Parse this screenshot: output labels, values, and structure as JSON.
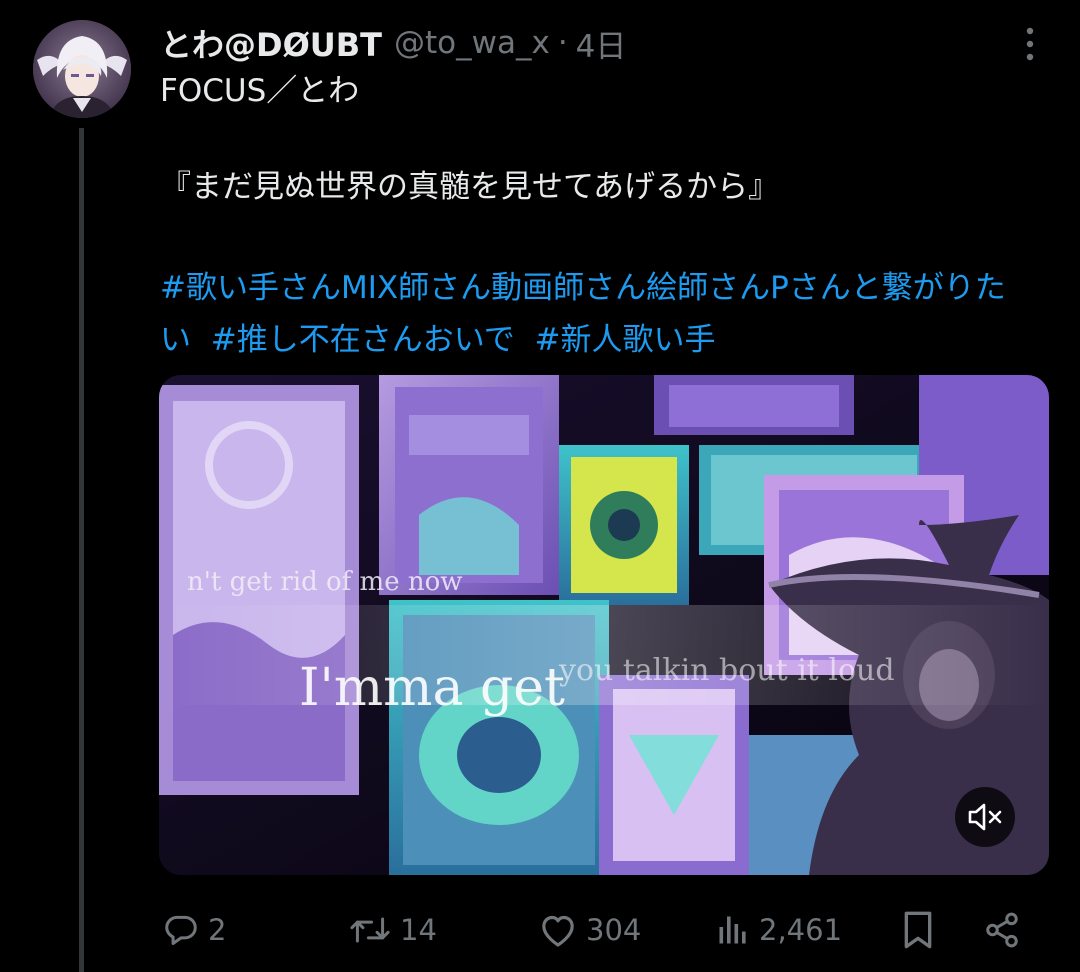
{
  "post": {
    "display_name": "とわ@DØUBT",
    "handle": "@to_wa_x",
    "separator": "·",
    "time": "4日",
    "title_line": "FOCUS／とわ",
    "quote_line": "『まだ見ぬ世界の真髄を見せてあげるから』",
    "hashtags": [
      "#歌い手さんMIX師さん動画師さん絵師さんPさんと繋がりたい",
      "#推し不在さんおいで",
      "#新人歌い手"
    ]
  },
  "media": {
    "lyric_small": "n't get rid of me now",
    "lyric_large_1": "I'mma get",
    "lyric_large_2": "you talkin bout it loud",
    "mute_icon": "speaker-muted-icon"
  },
  "actions": {
    "replies": "2",
    "reposts": "14",
    "likes": "304",
    "views": "2,461"
  },
  "colors": {
    "background": "#000000",
    "text": "#e7e9ea",
    "secondary": "#71767b",
    "link": "#1d9bf0",
    "thread_line": "#333639"
  }
}
